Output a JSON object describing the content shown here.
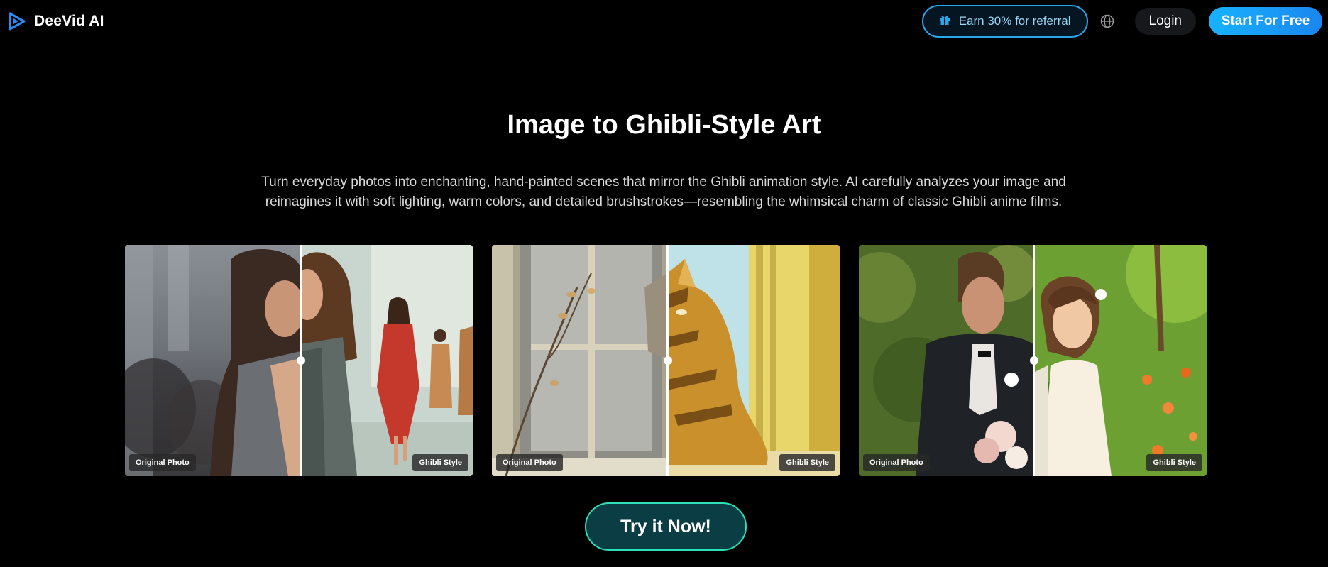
{
  "header": {
    "brand_name": "DeeVid AI",
    "referral_label": "Earn 30% for referral",
    "login_label": "Login",
    "start_label": "Start For Free"
  },
  "hero": {
    "title": "Image to Ghibli-Style Art",
    "description": "Turn everyday photos into enchanting, hand-painted scenes that mirror the Ghibli animation style. AI carefully analyzes your image and reimagines it with soft lighting, warm colors, and detailed brushstrokes—resembling the whimsical charm of classic Ghibli anime films."
  },
  "comparisons": [
    {
      "original_label": "Original Photo",
      "styled_label": "Ghibli Style",
      "subject": "runway model in grey blazer"
    },
    {
      "original_label": "Original Photo",
      "styled_label": "Ghibli Style",
      "subject": "tabby cat by window"
    },
    {
      "original_label": "Original Photo",
      "styled_label": "Ghibli Style",
      "subject": "groom and bride in garden"
    }
  ],
  "cta": {
    "label": "Try it Now!"
  },
  "colors": {
    "background": "#000000",
    "accent": "#18b2ff",
    "cta_border": "#2ee0b8"
  },
  "icons": {
    "logo": "play-logo-icon",
    "referral": "gift-icon",
    "language": "globe-icon"
  }
}
